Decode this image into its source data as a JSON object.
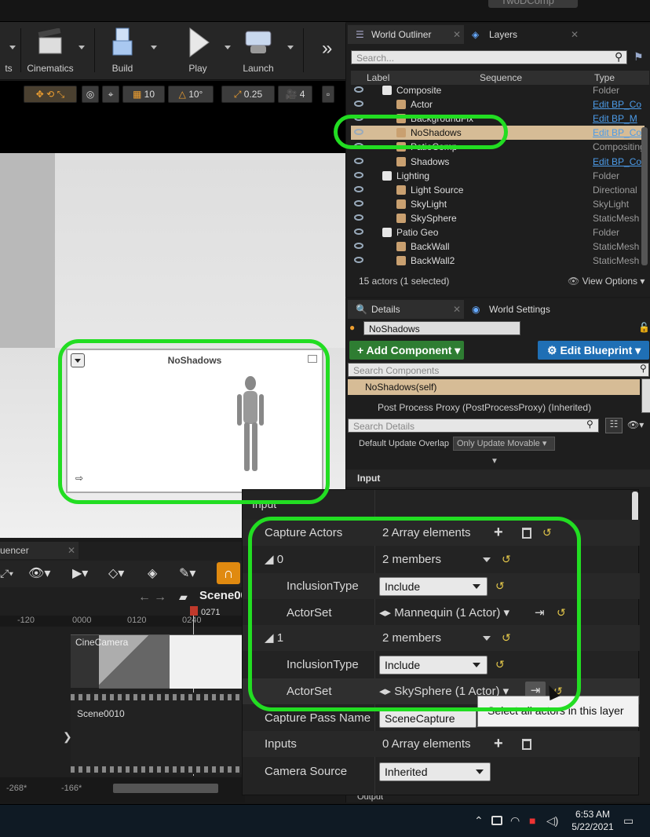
{
  "window": {
    "title_tab": "TwoDComp"
  },
  "toolbar": {
    "items": [
      {
        "label": "ts"
      },
      {
        "label": "Cinematics"
      },
      {
        "label": "Build"
      },
      {
        "label": "Play"
      },
      {
        "label": "Launch"
      }
    ],
    "overflow": "»"
  },
  "viewport": {
    "grid_snap": "10",
    "rot_snap": "10°",
    "scale_snap": "0.25",
    "camera_speed": "4",
    "preview": {
      "title": "NoShadows"
    }
  },
  "outliner": {
    "tabs": [
      "World Outliner",
      "Layers"
    ],
    "search_placeholder": "Search...",
    "columns": [
      "Label",
      "Sequence",
      "Type"
    ],
    "rows": [
      {
        "name": "Composite",
        "type": "Folder",
        "indent": 2,
        "link": false,
        "selected": false
      },
      {
        "name": "Actor",
        "type": "Edit BP_Co",
        "indent": 3,
        "link": true,
        "selected": false
      },
      {
        "name": "BackgroundFix",
        "type": "Edit BP_M",
        "indent": 3,
        "link": true,
        "selected": false
      },
      {
        "name": "NoShadows",
        "type": "Edit BP_Co",
        "indent": 3,
        "link": true,
        "selected": true
      },
      {
        "name": "PatioComp",
        "type": "Compositing",
        "indent": 3,
        "link": false,
        "selected": false
      },
      {
        "name": "Shadows",
        "type": "Edit BP_Co",
        "indent": 3,
        "link": true,
        "selected": false
      },
      {
        "name": "Lighting",
        "type": "Folder",
        "indent": 2,
        "link": false,
        "selected": false
      },
      {
        "name": "Light Source",
        "type": "Directional",
        "indent": 3,
        "link": false,
        "selected": false
      },
      {
        "name": "SkyLight",
        "type": "SkyLight",
        "indent": 3,
        "link": false,
        "selected": false
      },
      {
        "name": "SkySphere",
        "type": "StaticMesh",
        "indent": 3,
        "link": false,
        "selected": false
      },
      {
        "name": "Patio Geo",
        "type": "Folder",
        "indent": 2,
        "link": false,
        "selected": false
      },
      {
        "name": "BackWall",
        "type": "StaticMesh",
        "indent": 3,
        "link": false,
        "selected": false
      },
      {
        "name": "BackWall2",
        "type": "StaticMesh",
        "indent": 3,
        "link": false,
        "selected": false
      }
    ],
    "footer_count": "15 actors (1 selected)",
    "view_options": "View Options"
  },
  "details": {
    "tabs": [
      "Details",
      "World Settings"
    ],
    "actor_name": "NoShadows",
    "add_component": "+ Add Component",
    "edit_blueprint": "Edit Blueprint",
    "search_components_placeholder": "Search Components",
    "self_component": "NoShadows(self)",
    "proxy_component": "Post Process Proxy (PostProcessProxy) (Inherited)",
    "search_details_placeholder": "Search Details",
    "default_update_label": "Default Update Overlap",
    "default_update_value": "Only Update Movable",
    "input_section": "Input",
    "output_section": "Output"
  },
  "zoom": {
    "section": "Input",
    "capture_actors": {
      "label": "Capture Actors",
      "value": "2 Array elements"
    },
    "elements": [
      {
        "index": "0",
        "members": "2 members",
        "inclusion_label": "InclusionType",
        "inclusion_value": "Include",
        "actorset_label": "ActorSet",
        "actorset_value": "Mannequin (1 Actor)"
      },
      {
        "index": "1",
        "members": "2 members",
        "inclusion_label": "InclusionType",
        "inclusion_value": "Include",
        "actorset_label": "ActorSet",
        "actorset_value": "SkySphere (1 Actor)"
      }
    ],
    "capture_pass": {
      "label": "Capture Pass Name",
      "value": "SceneCapture"
    },
    "inputs": {
      "label": "Inputs",
      "value": "0 Array elements"
    },
    "camera_source": {
      "label": "Camera Source",
      "value": "Inherited"
    },
    "tooltip": "Select all actors in this layer"
  },
  "sequencer": {
    "tab": "uencer",
    "sequence_name": "Scene00",
    "playhead": "0271",
    "ruler": [
      "-120",
      "0000",
      "0120",
      "0240"
    ],
    "track_camera": "CineCamera",
    "track_scene": "Scene0010",
    "range_start": "-268*",
    "range_mid": "-166*"
  },
  "taskbar": {
    "time": "6:53 AM",
    "date": "5/22/2021"
  },
  "colors": {
    "highlight": "#22dd22",
    "selection": "#d6bc96",
    "add_button": "#2e7d32",
    "blueprint_button": "#1f6fb5"
  }
}
